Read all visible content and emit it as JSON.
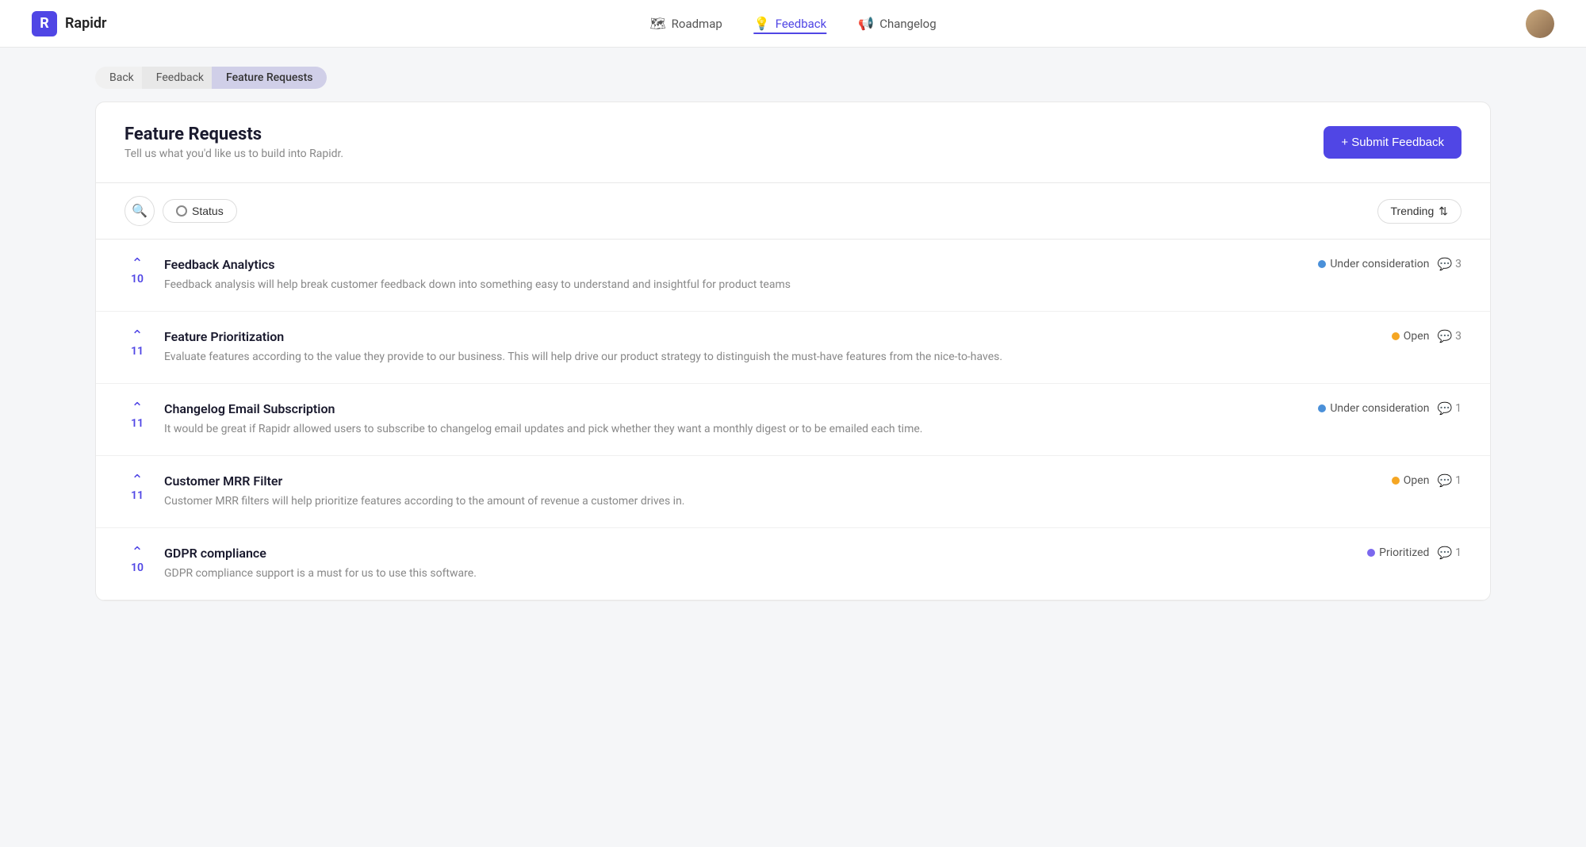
{
  "header": {
    "logo_letter": "R",
    "logo_name": "Rapidr",
    "nav": [
      {
        "id": "roadmap",
        "label": "Roadmap",
        "icon": "🗺",
        "active": false
      },
      {
        "id": "feedback",
        "label": "Feedback",
        "icon": "💡",
        "active": true
      },
      {
        "id": "changelog",
        "label": "Changelog",
        "icon": "📢",
        "active": false
      }
    ]
  },
  "breadcrumb": {
    "items": [
      {
        "id": "back",
        "label": "Back",
        "active": false
      },
      {
        "id": "feedback",
        "label": "Feedback",
        "active": false
      },
      {
        "id": "feature-requests",
        "label": "Feature Requests",
        "active": true
      }
    ]
  },
  "card": {
    "title": "Feature Requests",
    "subtitle": "Tell us what you'd like us to build into Rapidr.",
    "submit_button": "+ Submit Feedback"
  },
  "filters": {
    "search_label": "🔍",
    "status_label": "Status",
    "trending_label": "Trending",
    "sort_icon": "↕"
  },
  "feedback_items": [
    {
      "id": "feedback-analytics",
      "title": "Feedback Analytics",
      "description": "Feedback analysis will help break customer feedback down into something easy to understand and insightful for product teams",
      "votes": "10",
      "status": "Under consideration",
      "status_type": "blue",
      "comments": "3"
    },
    {
      "id": "feature-prioritization",
      "title": "Feature Prioritization",
      "description": "Evaluate features according to the value they provide to our business. This will help drive our product strategy to distinguish the must-have features from the nice-to-haves.",
      "votes": "11",
      "status": "Open",
      "status_type": "orange",
      "comments": "3"
    },
    {
      "id": "changelog-email-subscription",
      "title": "Changelog Email Subscription",
      "description": "It would be great if Rapidr allowed users to subscribe to changelog email updates and pick whether they want a monthly digest or to be emailed each time.",
      "votes": "11",
      "status": "Under consideration",
      "status_type": "blue",
      "comments": "1"
    },
    {
      "id": "customer-mrr-filter",
      "title": "Customer MRR Filter",
      "description": "Customer MRR filters will help prioritize features according to the amount of revenue a customer drives in.",
      "votes": "11",
      "status": "Open",
      "status_type": "orange",
      "comments": "1"
    },
    {
      "id": "gdpr-compliance",
      "title": "GDPR compliance",
      "description": "GDPR compliance support is a must for us to use this software.",
      "votes": "10",
      "status": "Prioritized",
      "status_type": "purple",
      "comments": "1"
    }
  ]
}
